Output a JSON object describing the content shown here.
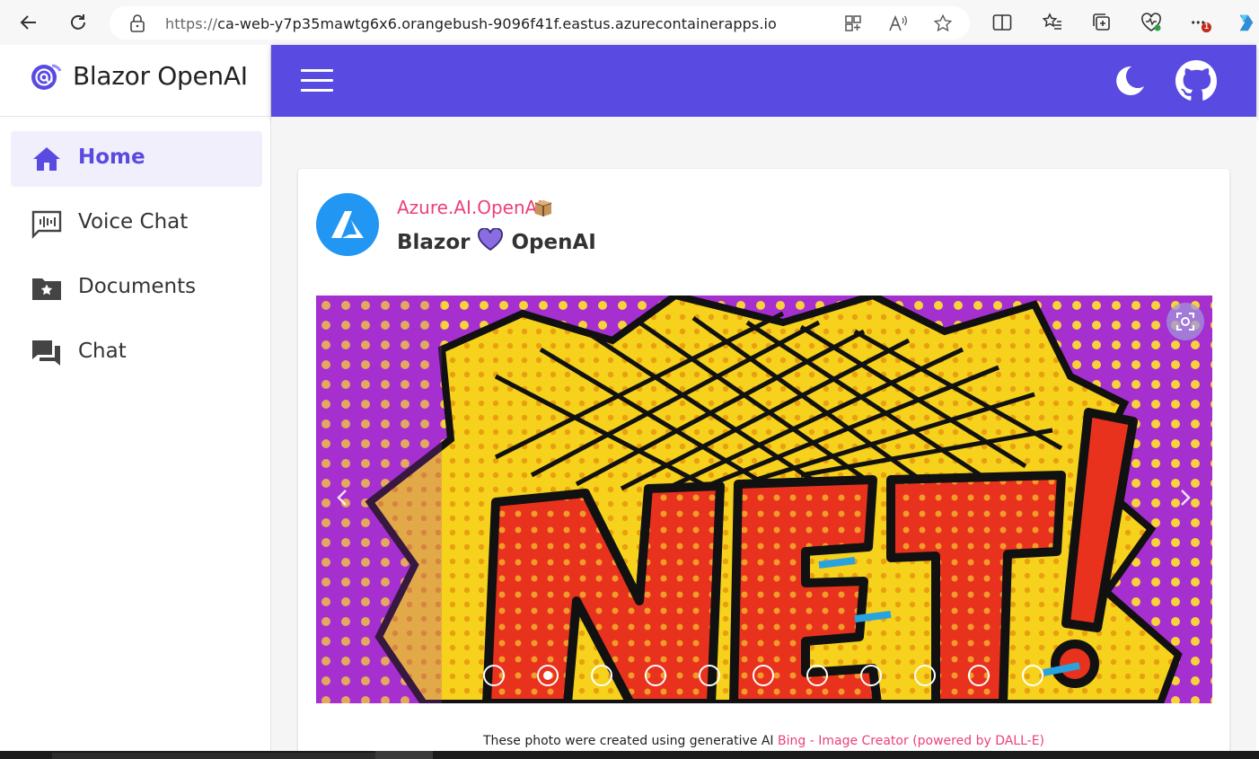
{
  "browser": {
    "url_scheme": "https://",
    "url_rest": "ca-web-y7p35mawtg6x6.orangebush-9096f41f.eastus.azurecontainerapps.io",
    "notification_count": "1"
  },
  "brand": {
    "title": "Blazor OpenAI"
  },
  "sidebar": {
    "items": [
      {
        "label": "Home",
        "icon": "home-icon",
        "active": true
      },
      {
        "label": "Voice Chat",
        "icon": "voice-chat-icon",
        "active": false
      },
      {
        "label": "Documents",
        "icon": "folder-star-icon",
        "active": false
      },
      {
        "label": "Chat",
        "icon": "chat-icon",
        "active": false
      }
    ]
  },
  "appbar": {
    "accent": "#594ae2"
  },
  "card": {
    "subtitle": "Azure.AI.OpenAI",
    "title_left": "Blazor",
    "title_right": "OpenAI",
    "carousel": {
      "slide_count": 11,
      "active_index": 1
    },
    "caption_text": "These photo were created using generative AI ",
    "caption_link": "Bing - Image Creator (powered by DALL-E)"
  },
  "colors": {
    "accent": "#594ae2",
    "pink": "#ec407a",
    "avatar_blue": "#2196f3"
  }
}
